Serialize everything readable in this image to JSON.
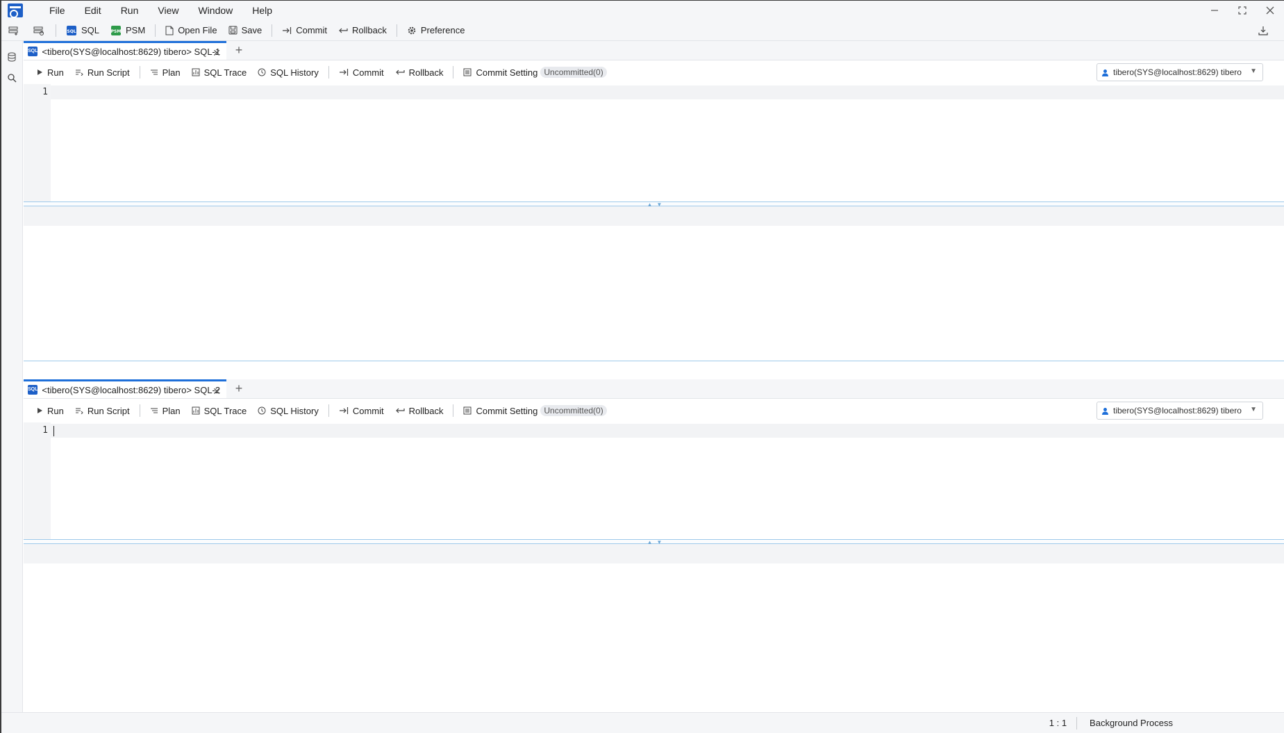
{
  "menubar": {
    "items": [
      {
        "label": "File"
      },
      {
        "label": "Edit"
      },
      {
        "label": "Run"
      },
      {
        "label": "View"
      },
      {
        "label": "Window"
      },
      {
        "label": "Help"
      }
    ]
  },
  "toolbar": {
    "sql_label": "SQL",
    "psm_label": "PSM",
    "open_file_label": "Open File",
    "save_label": "Save",
    "commit_label": "Commit",
    "rollback_label": "Rollback",
    "preference_label": "Preference"
  },
  "editors": [
    {
      "tab_label": "<tibero(SYS@localhost:8629) tibero> SQL-1",
      "line_number": "1",
      "toolbar": {
        "run": "Run",
        "run_script": "Run Script",
        "plan": "Plan",
        "sql_trace": "SQL Trace",
        "sql_history": "SQL History",
        "commit": "Commit",
        "rollback": "Rollback",
        "commit_setting": "Commit Setting",
        "uncommitted": "Uncommitted(0)"
      },
      "connection": "tibero(SYS@localhost:8629) tibero"
    },
    {
      "tab_label": "<tibero(SYS@localhost:8629) tibero> SQL-2",
      "line_number": "1",
      "toolbar": {
        "run": "Run",
        "run_script": "Run Script",
        "plan": "Plan",
        "sql_trace": "SQL Trace",
        "sql_history": "SQL History",
        "commit": "Commit",
        "rollback": "Rollback",
        "commit_setting": "Commit Setting",
        "uncommitted": "Uncommitted(0)"
      },
      "connection": "tibero(SYS@localhost:8629) tibero"
    }
  ],
  "statusbar": {
    "cursor_position": "1 : 1",
    "background_process": "Background Process"
  },
  "colors": {
    "accent": "#1e6fd9",
    "splitter": "#9ec9ea",
    "psm_green": "#2e9b4a"
  }
}
